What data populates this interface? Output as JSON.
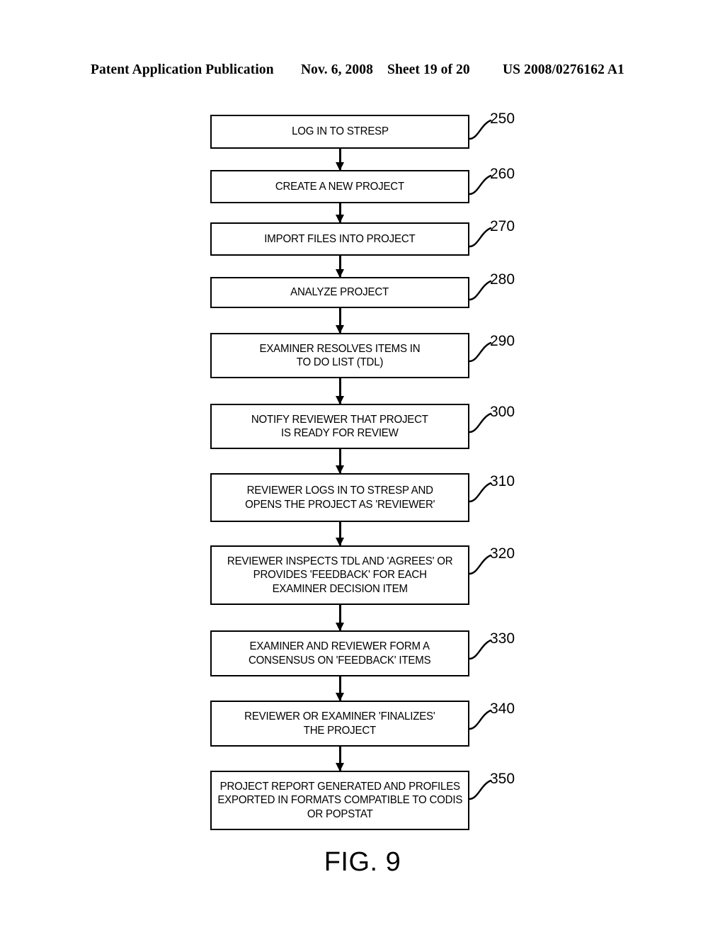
{
  "header": {
    "publication": "Patent Application Publication",
    "date": "Nov. 6, 2008",
    "sheet": "Sheet 19 of 20",
    "patent_number": "US 2008/0276162 A1"
  },
  "figure": {
    "caption": "FIG. 9"
  },
  "flowchart": {
    "type": "flowchart",
    "orientation": "vertical",
    "steps": [
      {
        "ref": "250",
        "text": "LOG IN TO STRESP",
        "lines": 1
      },
      {
        "ref": "260",
        "text": "CREATE A NEW PROJECT",
        "lines": 1
      },
      {
        "ref": "270",
        "text": "IMPORT FILES INTO PROJECT",
        "lines": 1
      },
      {
        "ref": "280",
        "text": "ANALYZE PROJECT",
        "lines": 1
      },
      {
        "ref": "290",
        "text": "EXAMINER RESOLVES ITEMS IN\nTO DO LIST (TDL)",
        "lines": 2
      },
      {
        "ref": "300",
        "text": "NOTIFY REVIEWER THAT PROJECT\nIS READY FOR REVIEW",
        "lines": 2
      },
      {
        "ref": "310",
        "text": "REVIEWER LOGS IN TO STRESP AND\nOPENS THE PROJECT AS 'REVIEWER'",
        "lines": 2
      },
      {
        "ref": "320",
        "text": "REVIEWER INSPECTS TDL AND 'AGREES' OR\nPROVIDES 'FEEDBACK' FOR EACH\nEXAMINER DECISION ITEM",
        "lines": 3
      },
      {
        "ref": "330",
        "text": "EXAMINER AND REVIEWER FORM A\nCONSENSUS ON 'FEEDBACK' ITEMS",
        "lines": 2
      },
      {
        "ref": "340",
        "text": "REVIEWER OR EXAMINER 'FINALIZES'\nTHE PROJECT",
        "lines": 2
      },
      {
        "ref": "350",
        "text": "PROJECT REPORT GENERATED AND PROFILES\nEXPORTED IN FORMATS COMPATIBLE TO CODIS\nOR POPSTAT",
        "lines": 3
      }
    ]
  },
  "colors": {
    "ink": "#000000",
    "paper": "#ffffff"
  }
}
